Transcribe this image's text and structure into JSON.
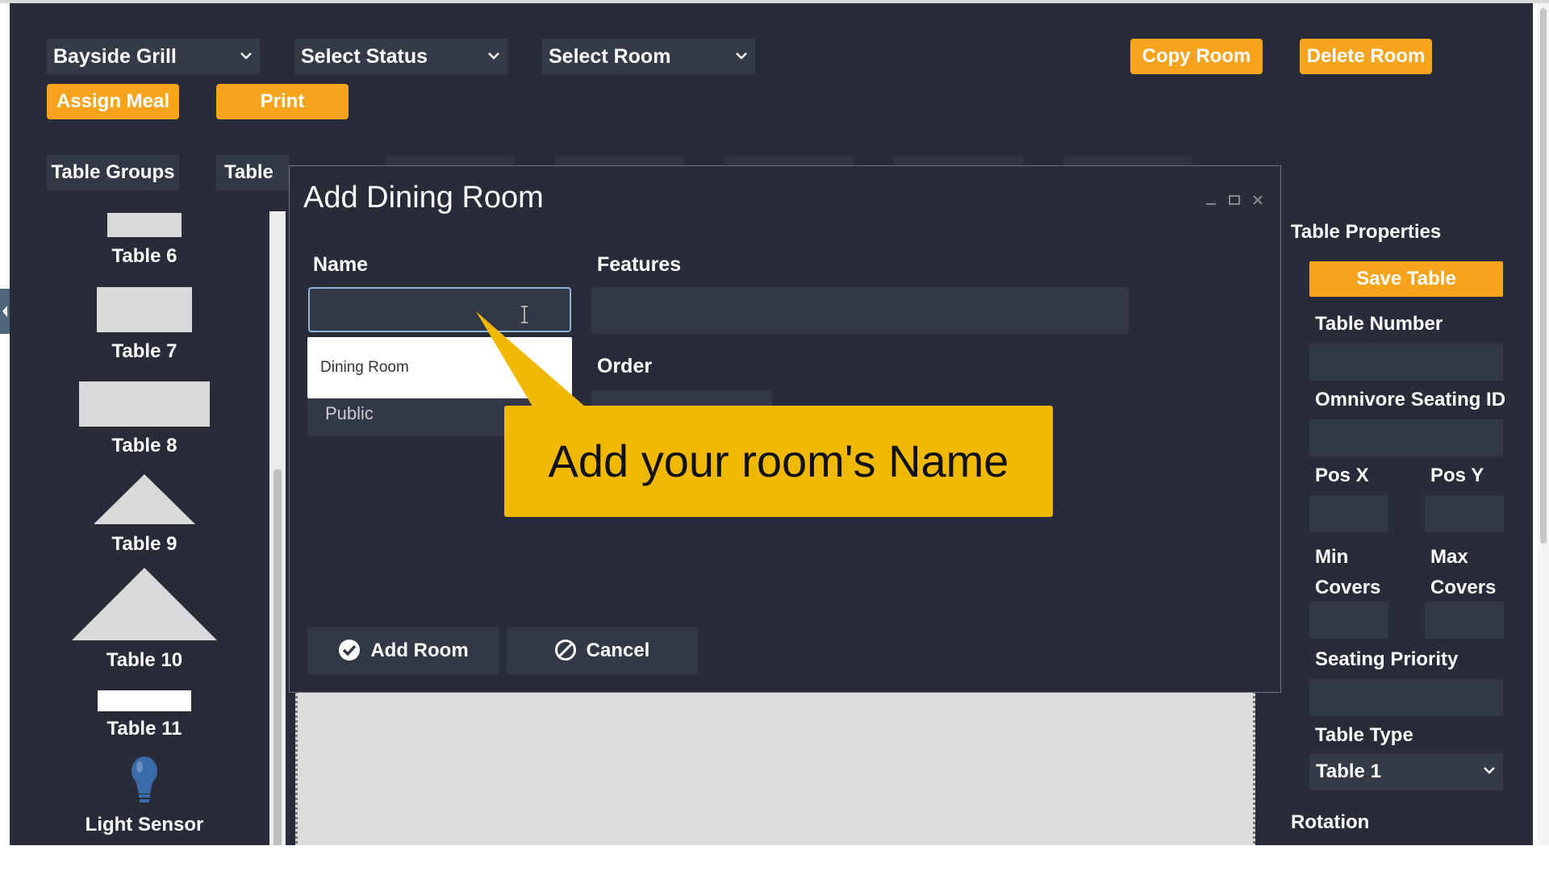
{
  "toolbar": {
    "restaurant_select": "Bayside Grill",
    "status_select": "Select Status",
    "room_select": "Select Room",
    "copy_room_label": "Copy Room",
    "delete_room_label": "Delete Room",
    "assign_meal_label": "Assign Meal",
    "print_label": "Print"
  },
  "tabs": {
    "table_groups": "Table Groups",
    "table_partial": "Table F"
  },
  "palette": {
    "items": [
      {
        "label": "Table 6",
        "shape": "rect"
      },
      {
        "label": "Table 7",
        "shape": "rect"
      },
      {
        "label": "Table 8",
        "shape": "rect"
      },
      {
        "label": "Table 9",
        "shape": "triangle"
      },
      {
        "label": "Table 10",
        "shape": "triangle"
      },
      {
        "label": "Table 11",
        "shape": "rect-white"
      },
      {
        "label": "Light Sensor",
        "shape": "lightbulb-icon"
      }
    ]
  },
  "properties": {
    "heading": "Table Properties",
    "save_table_label": "Save Table",
    "table_number_label": "Table Number",
    "omnivore_label": "Omnivore Seating ID",
    "pos_x_label": "Pos X",
    "pos_y_label": "Pos Y",
    "min_covers_line1": "Min",
    "min_covers_line2": "Covers",
    "max_covers_line1": "Max",
    "max_covers_line2": "Covers",
    "seating_priority_label": "Seating Priority",
    "table_type_label": "Table Type",
    "table_type_value": "Table 1",
    "rotation_label": "Rotation"
  },
  "modal": {
    "title": "Add Dining Room",
    "name_label": "Name",
    "name_value": "",
    "name_suggestion": "Dining Room",
    "visibility_value": "Public",
    "features_label": "Features",
    "order_label": "Order",
    "add_room_label": "Add Room",
    "cancel_label": "Cancel"
  },
  "callout": {
    "text": "Add your room's Name"
  },
  "colors": {
    "accent": "#f7a41d",
    "background": "#272c38",
    "field": "#323845",
    "callout": "#f0b800"
  }
}
